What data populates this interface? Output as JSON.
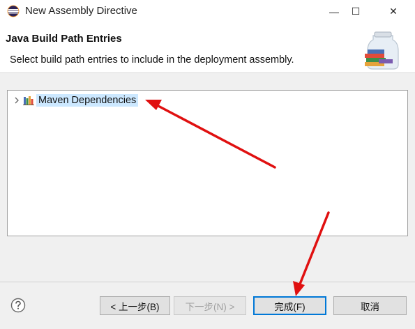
{
  "window": {
    "title": "New Assembly Directive",
    "icon": "eclipse-icon",
    "minimize_glyph": "—",
    "maximize_glyph": "☐",
    "close_glyph": "✕"
  },
  "header": {
    "title": "Java Build Path Entries",
    "description": "Select build path entries to include in the deployment assembly.",
    "image": "library-jar-icon"
  },
  "tree": {
    "items": [
      {
        "label": "Maven Dependencies",
        "icon": "library-icon",
        "expanded": false,
        "selected": true
      }
    ]
  },
  "buttons": {
    "back": "< 上一步(B)",
    "next": "下一步(N) >",
    "finish": "完成(F)",
    "cancel": "取消"
  },
  "colors": {
    "accent": "#0078d7",
    "selection": "#cce8ff",
    "annotation_arrow": "#e01010"
  }
}
